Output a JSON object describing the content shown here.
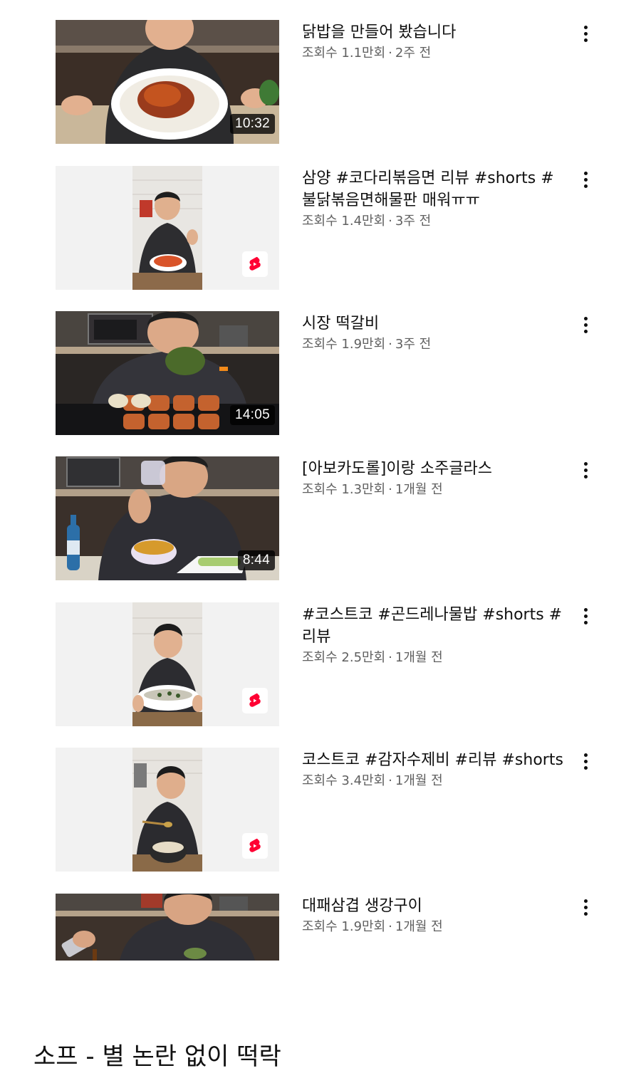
{
  "videos": [
    {
      "title": "닭밥을 만들어 봤습니다",
      "views": "조회수 1.1만회",
      "sep": "·",
      "age": "2주 전",
      "duration": "10:32",
      "type": "video"
    },
    {
      "title": "삼양 #코다리볶음면 리뷰 #shorts #불닭볶음면해물판 매워ㅠㅠ",
      "views": "조회수 1.4만회",
      "sep": "·",
      "age": "3주 전",
      "type": "shorts"
    },
    {
      "title": "시장 떡갈비",
      "views": "조회수 1.9만회",
      "sep": "·",
      "age": "3주 전",
      "duration": "14:05",
      "type": "video"
    },
    {
      "title": "[아보카도롤]이랑 소주글라스",
      "views": "조회수 1.3만회",
      "sep": "·",
      "age": "1개월 전",
      "duration": "8:44",
      "type": "video"
    },
    {
      "title": "#코스트코 #곤드레나물밥 #shorts #리뷰",
      "views": "조회수 2.5만회",
      "sep": "·",
      "age": "1개월 전",
      "type": "shorts"
    },
    {
      "title": "코스트코 #감자수제비 #리뷰 #shorts",
      "views": "조회수 3.4만회",
      "sep": "·",
      "age": "1개월 전",
      "type": "shorts"
    },
    {
      "title": "대패삼겹 생강구이",
      "views": "조회수 1.9만회",
      "sep": "·",
      "age": "1개월 전",
      "type": "video"
    }
  ],
  "caption": "소프 - 별 논란 없이 떡락",
  "colors": {
    "shorts_red": "#ff0033",
    "subtext": "#606060",
    "text": "#0f0f0f"
  },
  "icons": {
    "more": "more-vert-icon",
    "shorts": "shorts-logo-icon"
  }
}
